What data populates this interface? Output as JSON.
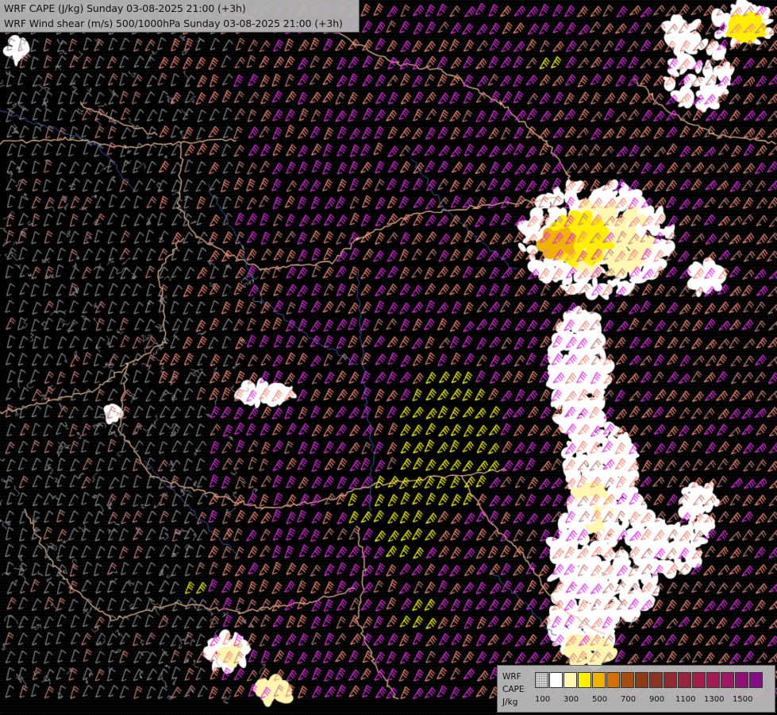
{
  "header": {
    "line1": "WRF CAPE (J/kg) Sunday 03-08-2025 21:00 (+3h)",
    "line2": "WRF Wind shear (m/s) 500/1000hPa Sunday 03-08-2025 21:00 (+3h)"
  },
  "legend": {
    "model_label": "WRF",
    "field_label": "CAPE",
    "unit_label": "J/kg",
    "tick_labels": [
      "100",
      "300",
      "500",
      "700",
      "900",
      "1100",
      "1300",
      "1500"
    ],
    "colors": [
      "#d8d8d8",
      "#ffffff",
      "#fff6b0",
      "#ffee00",
      "#f0b400",
      "#d27000",
      "#a94c10",
      "#8e3a14",
      "#8a3322",
      "#902a2e",
      "#98243a",
      "#a01e48",
      "#a41a58",
      "#a0166a",
      "#940e78",
      "#880a86"
    ]
  },
  "map": {
    "background": "#000000",
    "border_color": "#e8b894",
    "river_color": "#3b5ba8",
    "barb_colors": {
      "weak": "#8a8a8a",
      "light": "#c28078",
      "moderate": "#f08a78",
      "strong": "#e030e0",
      "extreme": "#ffff00"
    }
  }
}
